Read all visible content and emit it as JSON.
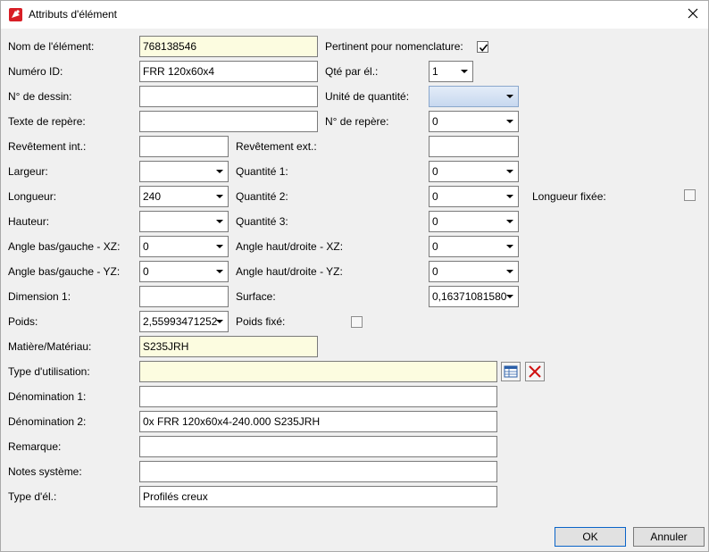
{
  "window": {
    "title": "Attributs d'élément",
    "icon": "app-logo-icon",
    "close_icon": "close-icon"
  },
  "fields": {
    "nom_label": "Nom de l'élément:",
    "nom_value": "768138546",
    "numero_label": "Numéro ID:",
    "numero_value": "FRR 120x60x4",
    "dessin_label": "N° de dessin:",
    "dessin_value": "",
    "texte_label": "Texte de repère:",
    "texte_value": "",
    "rev_int_label": "Revêtement int.:",
    "rev_int_value": "",
    "largeur_label": "Largeur:",
    "largeur_value": "",
    "longueur_label": "Longueur:",
    "longueur_value": "240",
    "hauteur_label": "Hauteur:",
    "hauteur_value": "",
    "angle_bg_xz_label": "Angle bas/gauche - XZ:",
    "angle_bg_xz_value": "0",
    "angle_bg_yz_label": "Angle bas/gauche - YZ:",
    "angle_bg_yz_value": "0",
    "dim1_label": "Dimension 1:",
    "dim1_value": "",
    "poids_label": "Poids:",
    "poids_value": "2,55993471252",
    "matiere_label": "Matière/Matériau:",
    "matiere_value": "S235JRH",
    "type_util_label": "Type d'utilisation:",
    "type_util_value": "",
    "denom1_label": "Dénomination 1:",
    "denom1_value": "",
    "denom2_label": "Dénomination 2:",
    "denom2_value": "0x FRR 120x60x4-240.000 S235JRH",
    "remarque_label": "Remarque:",
    "remarque_value": "",
    "notes_label": "Notes système:",
    "notes_value": "",
    "type_el_label": "Type d'él.:",
    "type_el_value": "Profilés creux"
  },
  "right_fields": {
    "pertinent_label": "Pertinent pour nomenclature:",
    "pertinent_checked": true,
    "qte_label": "Qté par él.:",
    "qte_value": "1",
    "unite_label": "Unité de quantité:",
    "unite_value": "",
    "num_repere_label": "N° de repère:",
    "num_repere_value": "0",
    "rev_ext_label": "Revêtement ext.:",
    "rev_ext_value": "",
    "q1_label": "Quantité 1:",
    "q1_value": "0",
    "q2_label": "Quantité 2:",
    "q2_value": "0",
    "q3_label": "Quantité 3:",
    "q3_value": "0",
    "angle_hd_xz_label": "Angle haut/droite - XZ:",
    "angle_hd_xz_value": "0",
    "angle_hd_yz_label": "Angle haut/droite - YZ:",
    "angle_hd_yz_value": "0",
    "surface_label": "Surface:",
    "surface_value": "0,16371081580",
    "poids_fixe_label": "Poids fixé:",
    "poids_fixe_checked": false,
    "longueur_fixee_label": "Longueur fixée:",
    "longueur_fixee_checked": false
  },
  "buttons": {
    "ok": "OK",
    "cancel": "Annuler",
    "table_icon": "table-select-icon",
    "delete_icon": "delete-x-icon"
  },
  "colors": {
    "highlight_field": "#fcfce0",
    "check_mark": "#000000",
    "delete_red": "#d01010",
    "default_button_border": "#0a64c8"
  }
}
